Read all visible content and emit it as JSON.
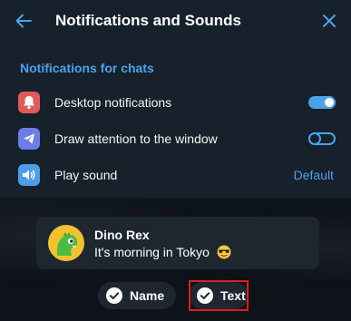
{
  "header": {
    "title": "Notifications and Sounds",
    "back_icon": "arrow-left-icon",
    "close_icon": "close-icon"
  },
  "section": {
    "title": "Notifications for chats"
  },
  "settings": [
    {
      "label": "Desktop notifications",
      "icon": "bell-icon",
      "icon_color": "#e05a5a",
      "control": "toggle",
      "enabled": true
    },
    {
      "label": "Draw attention to the window",
      "icon": "send-icon",
      "icon_color": "#6a7de8",
      "control": "toggle",
      "enabled": false
    },
    {
      "label": "Play sound",
      "icon": "speaker-icon",
      "icon_color": "#4b9ee8",
      "control": "link",
      "value": "Default"
    }
  ],
  "preview": {
    "sender": "Dino Rex",
    "message": "It's morning in Tokyo",
    "emoji": "sunglasses-emoji"
  },
  "options": [
    {
      "label": "Name",
      "checked": true
    },
    {
      "label": "Text",
      "checked": true,
      "highlighted": true
    }
  ],
  "colors": {
    "accent": "#4ca1ea",
    "panel": "#17212b",
    "highlight": "#e01b24"
  }
}
